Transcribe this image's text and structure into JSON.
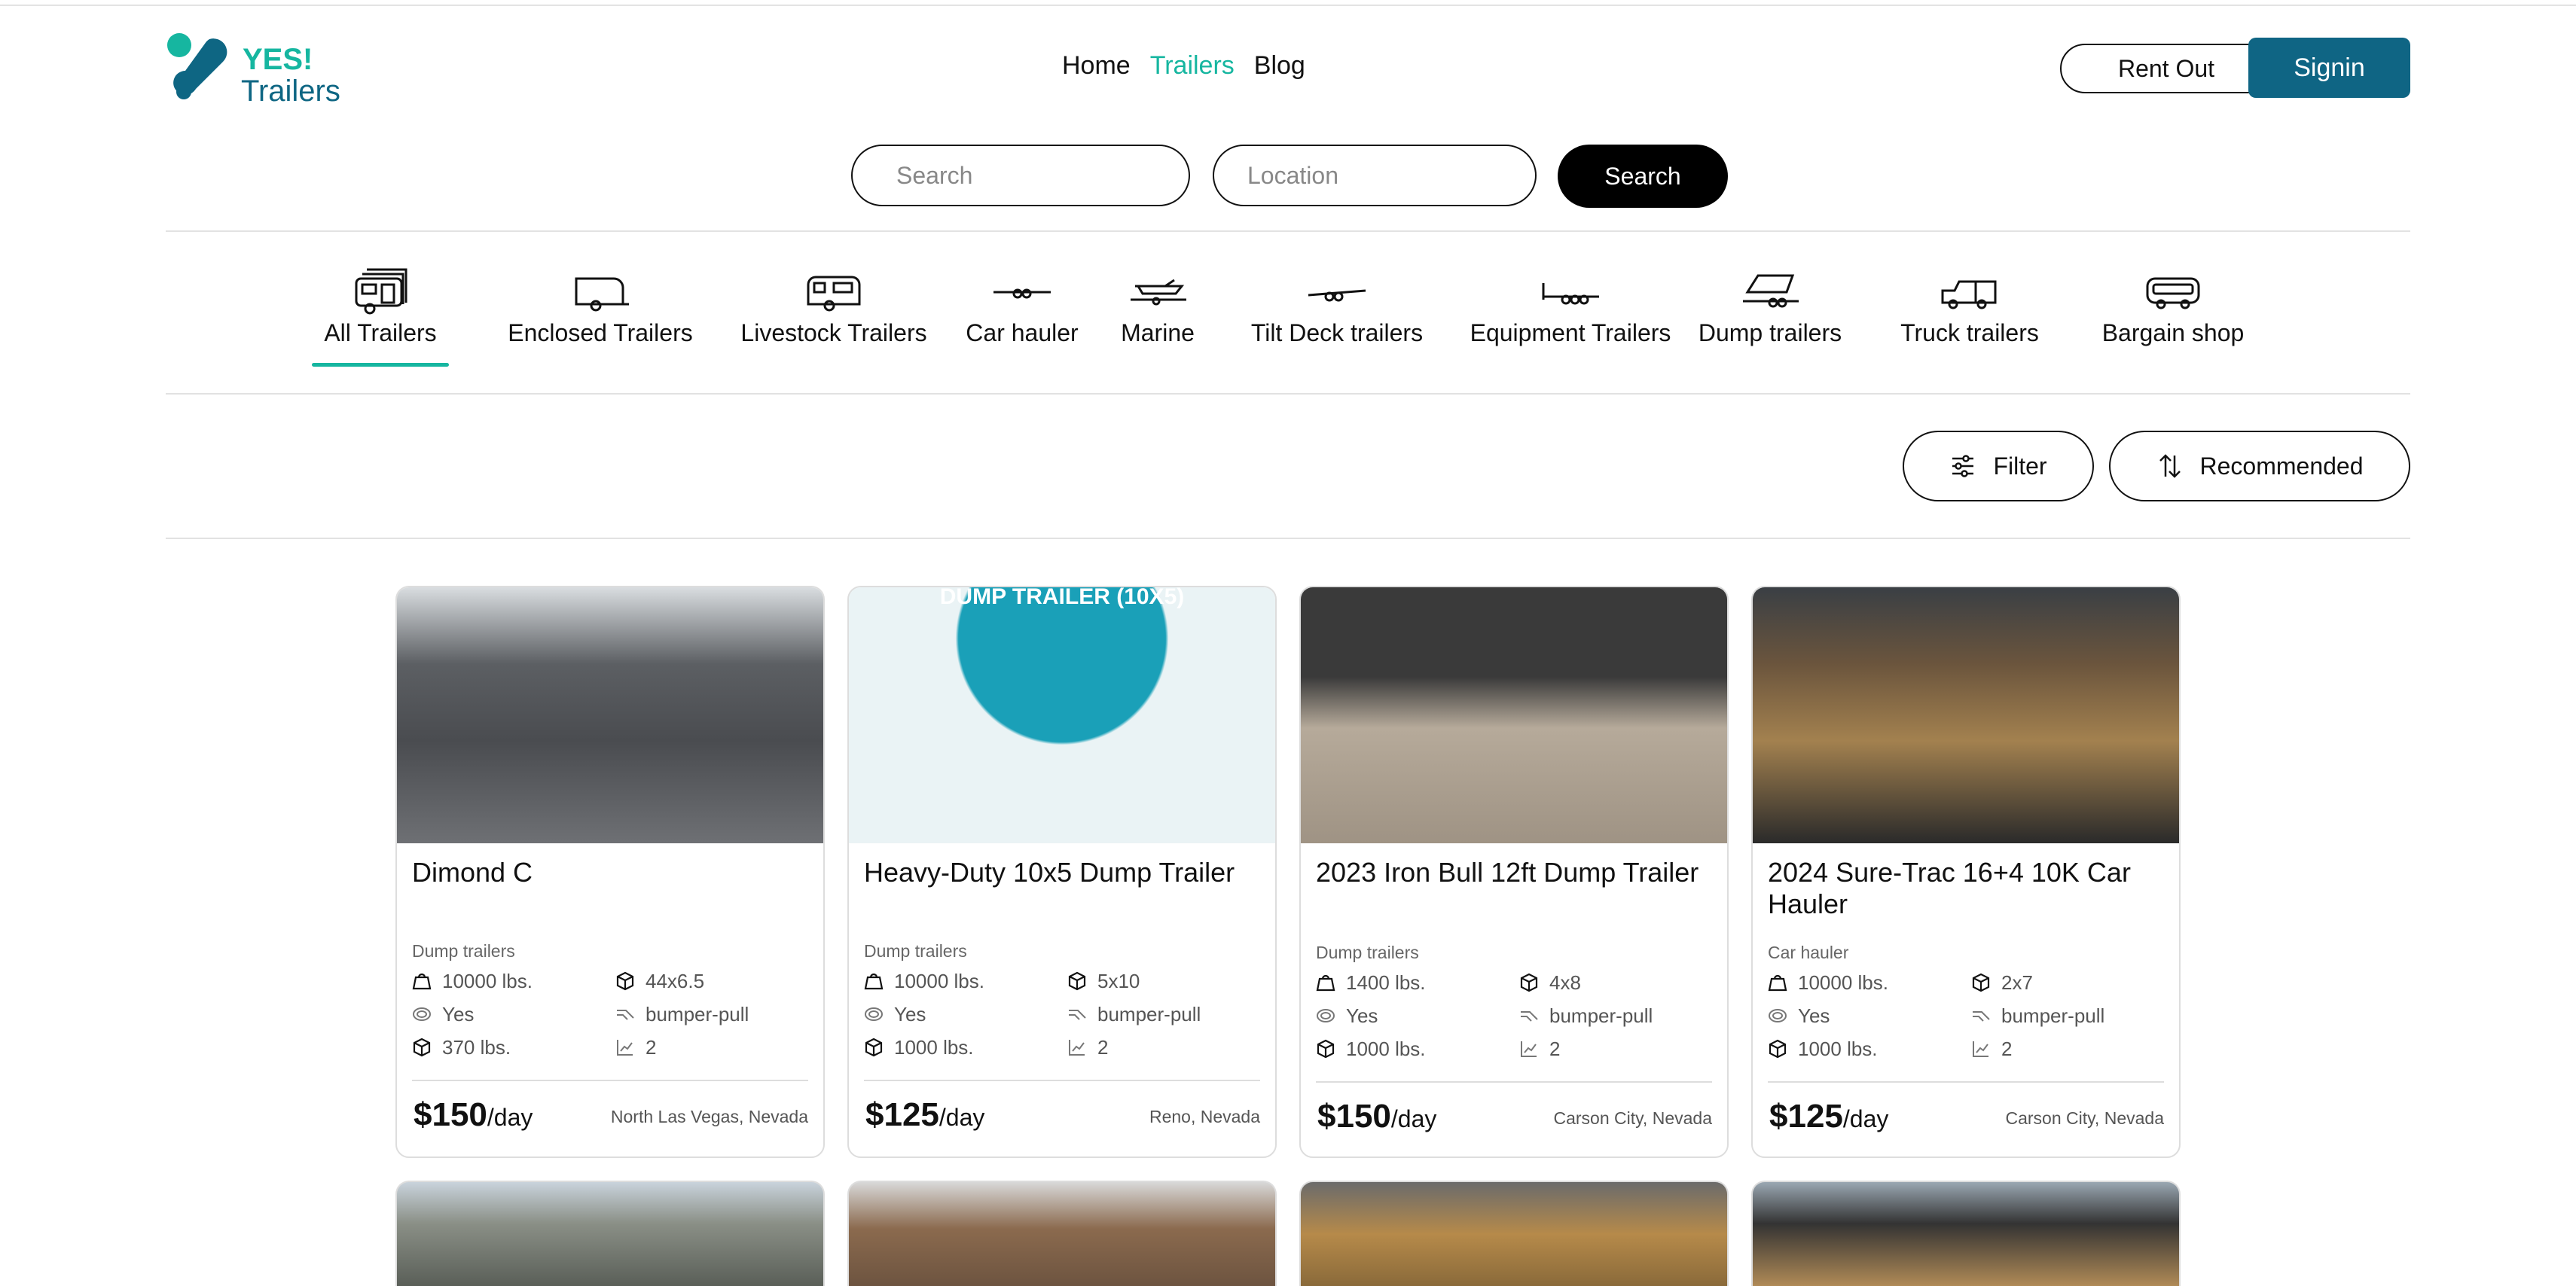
{
  "logo": {
    "line1": "YES!",
    "line2": "Trailers"
  },
  "nav": {
    "home": "Home",
    "trailers": "Trailers",
    "blog": "Blog"
  },
  "header": {
    "rent_out": "Rent Out",
    "signin": "Signin"
  },
  "search": {
    "search_placeholder": "Search",
    "location_placeholder": "Location",
    "button": "Search"
  },
  "categories": [
    {
      "label": "All Trailers",
      "icon": "rv-trailer-icon"
    },
    {
      "label": "Enclosed Trailers",
      "icon": "enclosed-trailer-icon"
    },
    {
      "label": "Livestock Trailers",
      "icon": "livestock-trailer-icon"
    },
    {
      "label": "Car hauler",
      "icon": "car-hauler-icon"
    },
    {
      "label": "Marine",
      "icon": "boat-trailer-icon"
    },
    {
      "label": "Tilt Deck trailers",
      "icon": "tilt-deck-icon"
    },
    {
      "label": "Equipment Trailers",
      "icon": "equipment-trailer-icon"
    },
    {
      "label": "Dump trailers",
      "icon": "dump-trailer-icon"
    },
    {
      "label": "Truck trailers",
      "icon": "truck-trailer-icon"
    },
    {
      "label": "Bargain shop",
      "icon": "bargain-shop-icon"
    }
  ],
  "filters": {
    "filter": "Filter",
    "sort": "Recommended"
  },
  "listings": [
    {
      "title": "Dimond C",
      "type": "Dump trailers",
      "weight": "10000 lbs.",
      "size": "44x6.5",
      "ramp": "Yes",
      "hitch": "bumper-pull",
      "payload": "370 lbs.",
      "axles": "2",
      "price": "$150",
      "unit": "/day",
      "location": "North Las Vegas, Nevada"
    },
    {
      "title": "Heavy-Duty 10x5 Dump Trailer",
      "type": "Dump trailers",
      "weight": "10000 lbs.",
      "size": "5x10",
      "ramp": "Yes",
      "hitch": "bumper-pull",
      "payload": "1000 lbs.",
      "axles": "2",
      "price": "$125",
      "unit": "/day",
      "location": "Reno, Nevada",
      "banner": "DUMP TRAILER (10X5)"
    },
    {
      "title": "2023 Iron Bull 12ft Dump Trailer",
      "type": "Dump trailers",
      "weight": "1400 lbs.",
      "size": "4x8",
      "ramp": "Yes",
      "hitch": "bumper-pull",
      "payload": "1000 lbs.",
      "axles": "2",
      "price": "$150",
      "unit": "/day",
      "location": "Carson City, Nevada"
    },
    {
      "title": "2024 Sure-Trac 16+4 10K Car Hauler",
      "type": "Car hauler",
      "weight": "10000 lbs.",
      "size": "2x7",
      "ramp": "Yes",
      "hitch": "bumper-pull",
      "payload": "1000 lbs.",
      "axles": "2",
      "price": "$125",
      "unit": "/day",
      "location": "Carson City, Nevada"
    }
  ],
  "colors": {
    "accent": "#16b6a0",
    "brand": "#0f6584"
  }
}
